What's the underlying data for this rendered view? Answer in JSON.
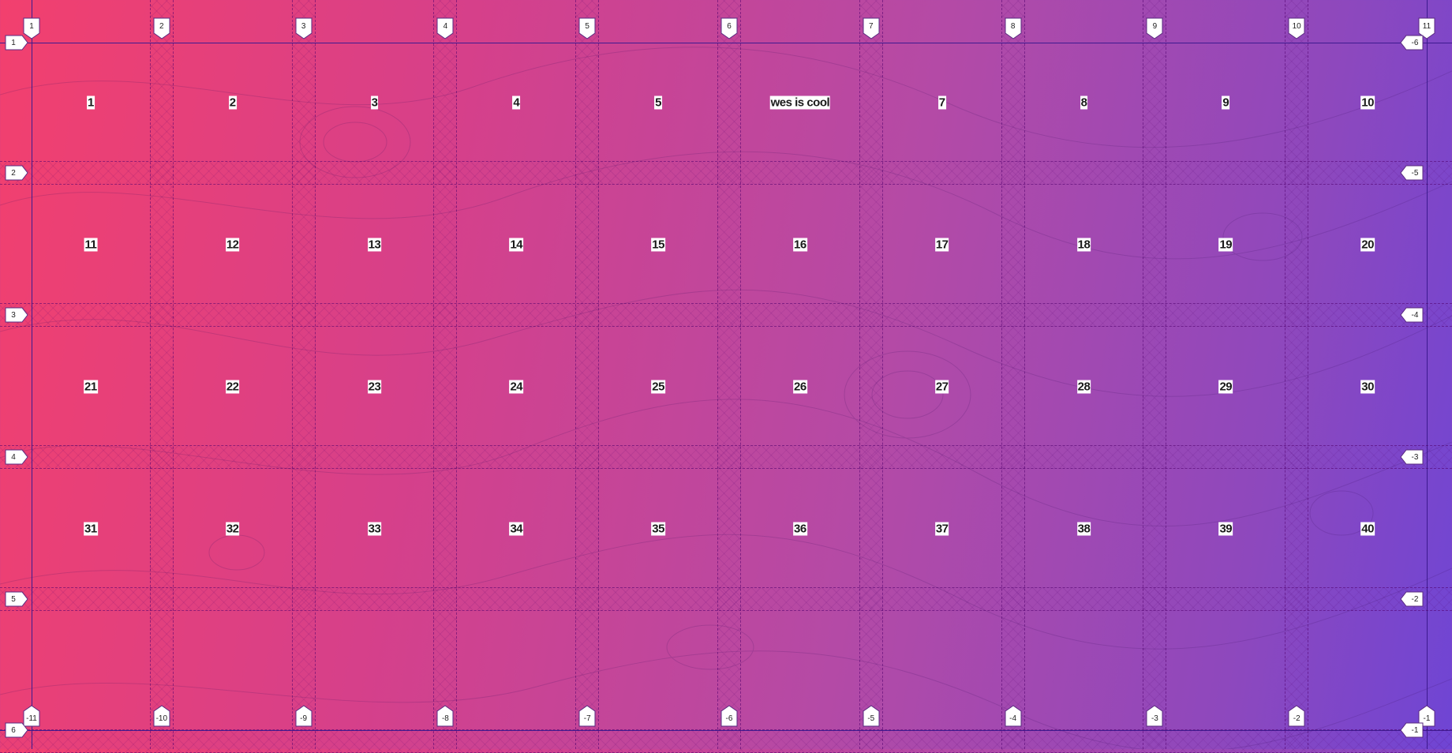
{
  "theme": {
    "gradient_start": "#f2406e",
    "gradient_end": "#6f45d4",
    "line_color": "#3d1a8f",
    "label_bg": "#ffffff"
  },
  "grid": {
    "columns": 10,
    "rows": 5,
    "cells": [
      "1",
      "2",
      "3",
      "4",
      "5",
      "wes is cool",
      "7",
      "8",
      "9",
      "10",
      "11",
      "12",
      "13",
      "14",
      "15",
      "16",
      "17",
      "18",
      "19",
      "20",
      "21",
      "22",
      "23",
      "24",
      "25",
      "26",
      "27",
      "28",
      "29",
      "30",
      "31",
      "32",
      "33",
      "34",
      "35",
      "36",
      "37",
      "38",
      "39",
      "40",
      "",
      "",
      "",
      "",
      "",
      "",
      "",
      "",
      "",
      ""
    ]
  },
  "column_line_labels": {
    "top": [
      "1",
      "2",
      "3",
      "4",
      "5",
      "6",
      "7",
      "8",
      "9",
      "10",
      "11"
    ],
    "bottom": [
      "-11",
      "-10",
      "-9",
      "-8",
      "-7",
      "-6",
      "-5",
      "-4",
      "-3",
      "-2",
      "-1"
    ]
  },
  "row_line_labels": {
    "left": [
      "1",
      "2",
      "3",
      "4",
      "5",
      "6"
    ],
    "right": [
      "-6",
      "-5",
      "-4",
      "-3",
      "-2",
      "-1"
    ]
  }
}
